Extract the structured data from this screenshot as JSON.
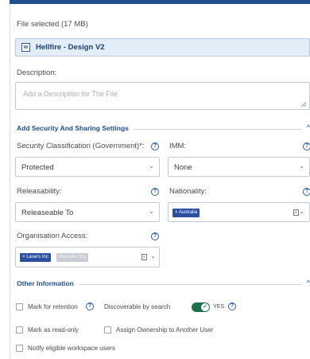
{
  "file": {
    "selected_text": "File selected (17 MB)",
    "name": "Hellfire - Design V2",
    "icon_letter": "w"
  },
  "description": {
    "label": "Description:",
    "placeholder": "Add a Description for The File"
  },
  "security_section": {
    "title": "Add Security And Sharing Settings",
    "caret": "^",
    "classification_label": "Security Classification (Government)*:",
    "classification_value": "Protected",
    "imm_label": "IMM:",
    "imm_value": "None",
    "releasability_label": "Releasability:",
    "releasability_value": "Releaseable To",
    "nationality_label": "Nationality:",
    "nationality_chips": [
      "× Australia"
    ],
    "org_access_label": "Organisation Access:",
    "org_chips": [
      "× Lasers Inc",
      "Marcelle Org"
    ]
  },
  "other_section": {
    "title": "Other Information",
    "caret": "^",
    "mark_retention": "Mark for retention",
    "discoverable_label": "Discoverable by search",
    "discoverable_value": "YES",
    "mark_readonly": "Mark as read-only",
    "assign_ownership": "Assign Ownership to Another User",
    "notify_users": "Notify eligible workspace users"
  },
  "help_glyph": "?",
  "chevron_glyph": "⌄",
  "colors": {
    "accent": "#1f4e8c",
    "chip": "#2d4fa0",
    "toggle_on": "#1f6f4f",
    "file_box_bg": "#e3edf8"
  }
}
